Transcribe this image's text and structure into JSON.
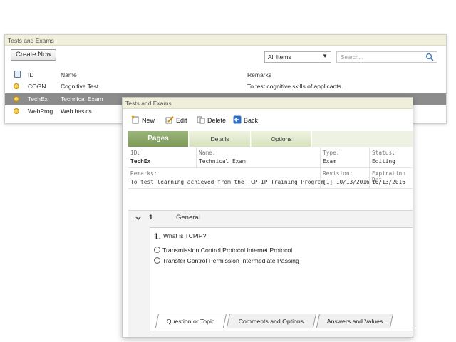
{
  "back_window": {
    "title": "Tests and Exams",
    "create_button": "Create Now",
    "filter_value": "All Items",
    "search_placeholder": "Search...",
    "columns": [
      "ID",
      "Name",
      "Remarks"
    ],
    "rows": [
      {
        "id": "COGN",
        "name": "Cognitive Test",
        "remarks": "To test cognitive skills of applicants."
      },
      {
        "id": "TechEx",
        "name": "Technical Exam",
        "remarks": "",
        "selected": true
      },
      {
        "id": "WebProg",
        "name": "Web basics",
        "remarks": ""
      }
    ]
  },
  "front_window": {
    "title": "Tests and Exams",
    "toolbar": {
      "new": "New",
      "edit": "Edit",
      "delete": "Delete",
      "back": "Back"
    },
    "tabs": [
      "Pages",
      "Details",
      "Options"
    ],
    "active_tab": "Pages",
    "info": {
      "id_label": "ID:",
      "id_value": "TechEx",
      "name_label": "Name:",
      "name_value": "Technical Exam",
      "type_label": "Type:",
      "type_value": "Exam",
      "status_label": "Status:",
      "status_value": "Editing",
      "remarks_label": "Remarks:",
      "remarks_value": "To test learning achieved from the TCP-IP Training Program",
      "revision_label": "Revision:",
      "revision_value": "[1] 10/13/2016",
      "expiration_label": "Expiration Dat",
      "expiration_value": "10/13/2016"
    },
    "section": {
      "number": "1",
      "name": "General"
    },
    "question": {
      "number": "1.",
      "text": "What is TCPIP?",
      "options": [
        "Transmission Control Protocol Internet Protocol",
        "Transfer Control Permission Intermediate Passing"
      ]
    },
    "bottom_tabs": [
      "Question or Topic",
      "Comments and Options",
      "Answers and Values"
    ]
  },
  "colors": {
    "tab_active": "#7c9a57",
    "title_bar": "#efefdc",
    "selected_row": "#8c8c8c",
    "status_dot": "#e2a80c"
  }
}
